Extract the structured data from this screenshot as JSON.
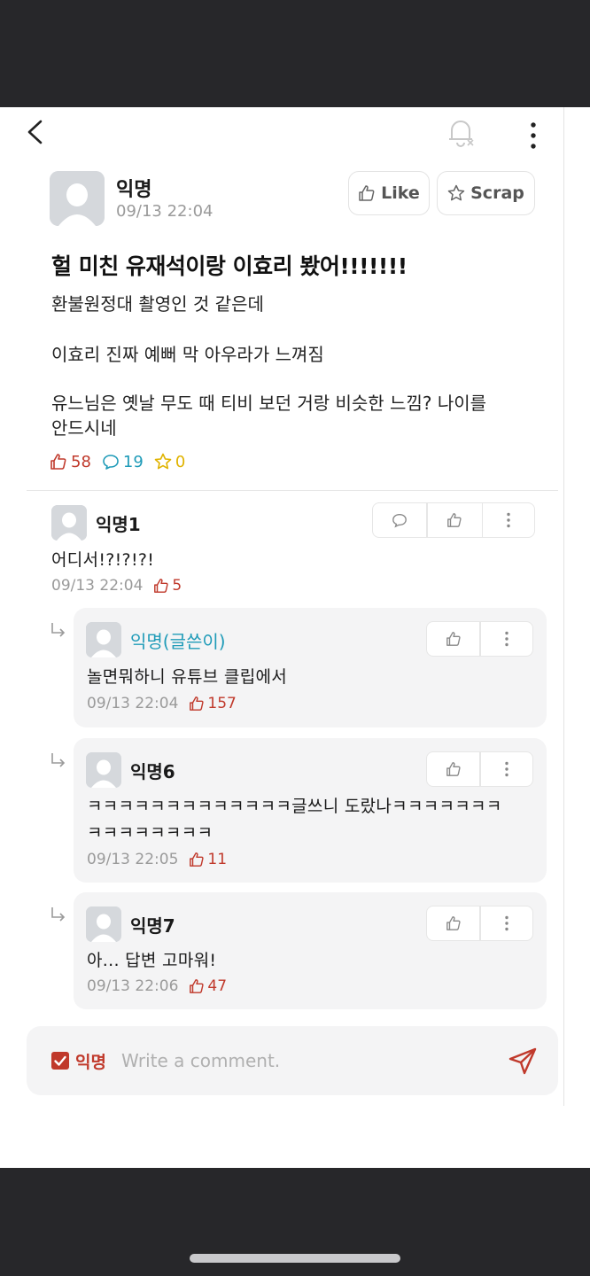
{
  "post": {
    "author": "익명",
    "time": "09/13 22:04",
    "like_label": "Like",
    "scrap_label": "Scrap",
    "title": "헐 미친 유재석이랑 이효리 봤어!!!!!!!",
    "lines": [
      "환불원정대 촬영인 것 같은데",
      "이효리 진짜 예뻐 막 아우라가 느껴짐",
      "유느님은 옛날 무도 때 티비 보던 거랑 비슷한 느낌? 나이를",
      "안드시네"
    ],
    "stats": {
      "likes": "58",
      "comments": "19",
      "scraps": "0"
    }
  },
  "comments": [
    {
      "author": "익명1",
      "text": "어디서!?!?!?!",
      "time": "09/13 22:04",
      "likes": "5"
    }
  ],
  "replies": [
    {
      "author": "익명(글쓴이)",
      "lines": [
        "놀면뭐하니 유튜브 클립에서"
      ],
      "time": "09/13 22:04",
      "likes": "157"
    },
    {
      "author": "익명6",
      "lines": [
        "ㅋㅋㅋㅋㅋㅋㅋㅋㅋㅋㅋㅋㅋ글쓰니 도랐나ㅋㅋㅋㅋㅋㅋㅋ",
        "ㅋㅋㅋㅋㅋㅋㅋㅋ"
      ],
      "time": "09/13 22:05",
      "likes": "11"
    },
    {
      "author": "익명7",
      "lines": [
        "아... 답변 고마워!"
      ],
      "time": "09/13 22:06",
      "likes": "47"
    }
  ],
  "composer": {
    "anon_label": "익명",
    "placeholder": "Write a comment."
  },
  "colors": {
    "accent_red": "#c0392b",
    "accent_teal": "#1f9bb8",
    "accent_gold": "#e0b300"
  }
}
